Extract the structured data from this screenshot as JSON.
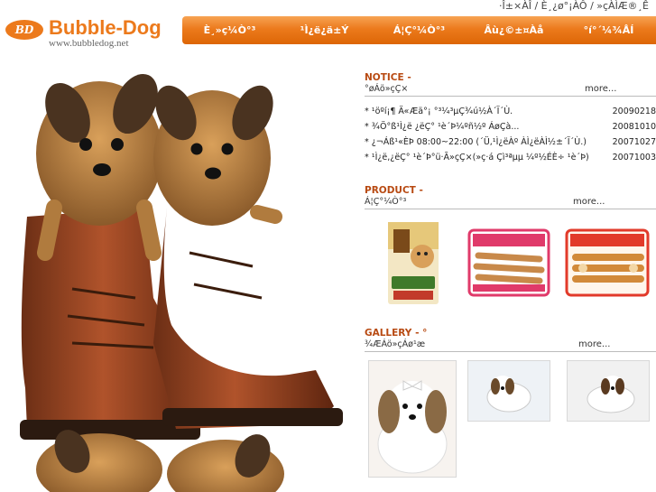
{
  "top_links": "·Î±×ÀÎ / È¸¿ø°¡ÀÔ / »çÀÌÆ®¸Ê",
  "logo": {
    "badge": "BD",
    "name": "Bubble-Dog",
    "url": "www.bubbledog.net"
  },
  "nav": [
    "È¸»ç¼Ò°³",
    "¹Ì¿ë¿ä±Ý",
    "Á¦Ç°¼Ò°³",
    "Âù¿©±¤Àå",
    "°í°´¼¾ÅÍ"
  ],
  "notice": {
    "title": "NOTICE -",
    "subtitle": "°øÁö»çÇ×",
    "more": "more...",
    "items": [
      {
        "text": "* ¹öºí¡¶ Ä«Æä°¡ °³¼³µÇ¾ú½À´Ï´Ù.",
        "date": "20090218"
      },
      {
        "text": "* ¾Ö°ß¹Ì¿ë ¿ëÇ° ¹è´Þ¼­ºñ½º ÁøÇà...",
        "date": "20081010"
      },
      {
        "text": "* ¿¬Áß¹«ÈÞ 08:00~22:00 (´Ü,¹Ì¿ëÀº ÀÌ¿ëÀÌ½±´Ï´Ù.)",
        "date": "20071027"
      },
      {
        "text": "* ¹Ì¿ë,¿ëÇ° ¹è´Þ°ü·Ã»çÇ×(»ç·á Çì³ªµµ ¼º½ÉÈ÷ ¹è´Þ)",
        "date": "20071003"
      }
    ]
  },
  "product": {
    "title": "PRODUCT -",
    "subtitle": "Á¦Ç°¼Ò°³",
    "more": "more..."
  },
  "gallery": {
    "title": "GALLERY - °",
    "subtitle": "¾ÆÁö»çÁø¹æ",
    "more": "more..."
  },
  "colors": {
    "brand_orange": "#ec7a1c",
    "section_title": "#b84a12"
  }
}
